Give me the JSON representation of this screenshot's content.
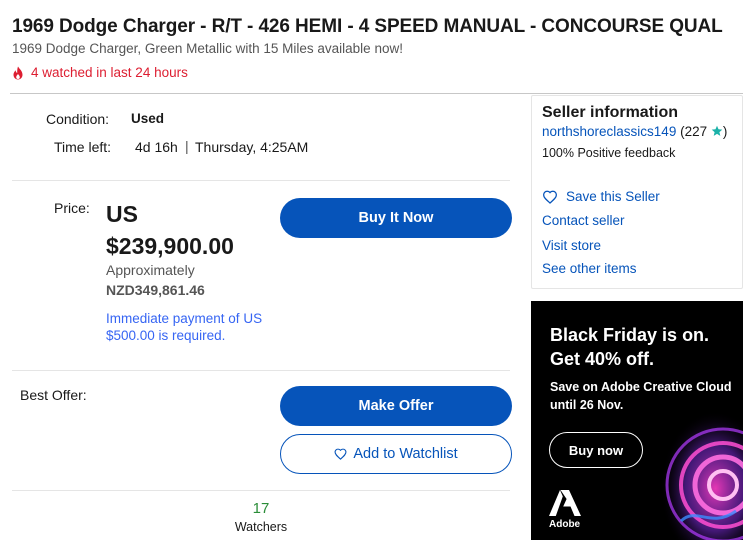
{
  "listing": {
    "title": "1969 Dodge Charger - R/T - 426 HEMI - 4 SPEED MANUAL - CONCOURSE QUAL",
    "subtitle": "1969 Dodge Charger, Green Metallic with 15 Miles available now!",
    "watched_notice": "4 watched in last 24 hours",
    "flame_icon": "flame-icon"
  },
  "details": {
    "condition_label": "Condition:",
    "condition_value": "Used",
    "time_label": "Time left:",
    "time_value": "4d 16h",
    "time_sep": "|",
    "time_end": "Thursday, 4:25AM"
  },
  "price": {
    "label": "Price:",
    "currency": "US",
    "amount": "$239,900.00",
    "approx_label": "Approximately",
    "approx_value": "NZD349,861.46",
    "deposit_notice": "Immediate payment of US $500.00 is required."
  },
  "actions": {
    "buy_now": "Buy It Now",
    "best_offer_label": "Best Offer:",
    "make_offer": "Make Offer",
    "watchlist": "Add to Watchlist",
    "heart_icon": "heart-icon"
  },
  "watchers": {
    "count": "17",
    "label": "Watchers"
  },
  "seller": {
    "title": "Seller information",
    "name": "northshoreclassics149",
    "rating": "(227",
    "rating_close": ")",
    "star_icon": "star-icon",
    "feedback": "100% Positive feedback",
    "save_seller": "Save this Seller",
    "contact": "Contact seller",
    "visit_store": "Visit store",
    "other_items": "See other items"
  },
  "ad": {
    "headline_1": "Black Friday is on.",
    "headline_2": "Get 40% off.",
    "sub_1": "Save on Adobe Creative Cloud",
    "sub_2": "until 26 Nov.",
    "button": "Buy now",
    "brand": "Adobe"
  },
  "colors": {
    "primary_blue": "#0654ba",
    "link_blue": "#3665f3",
    "alert_red": "#dd1e31",
    "watchers_green": "#2a8d38",
    "star_teal": "#1bb1a8"
  }
}
